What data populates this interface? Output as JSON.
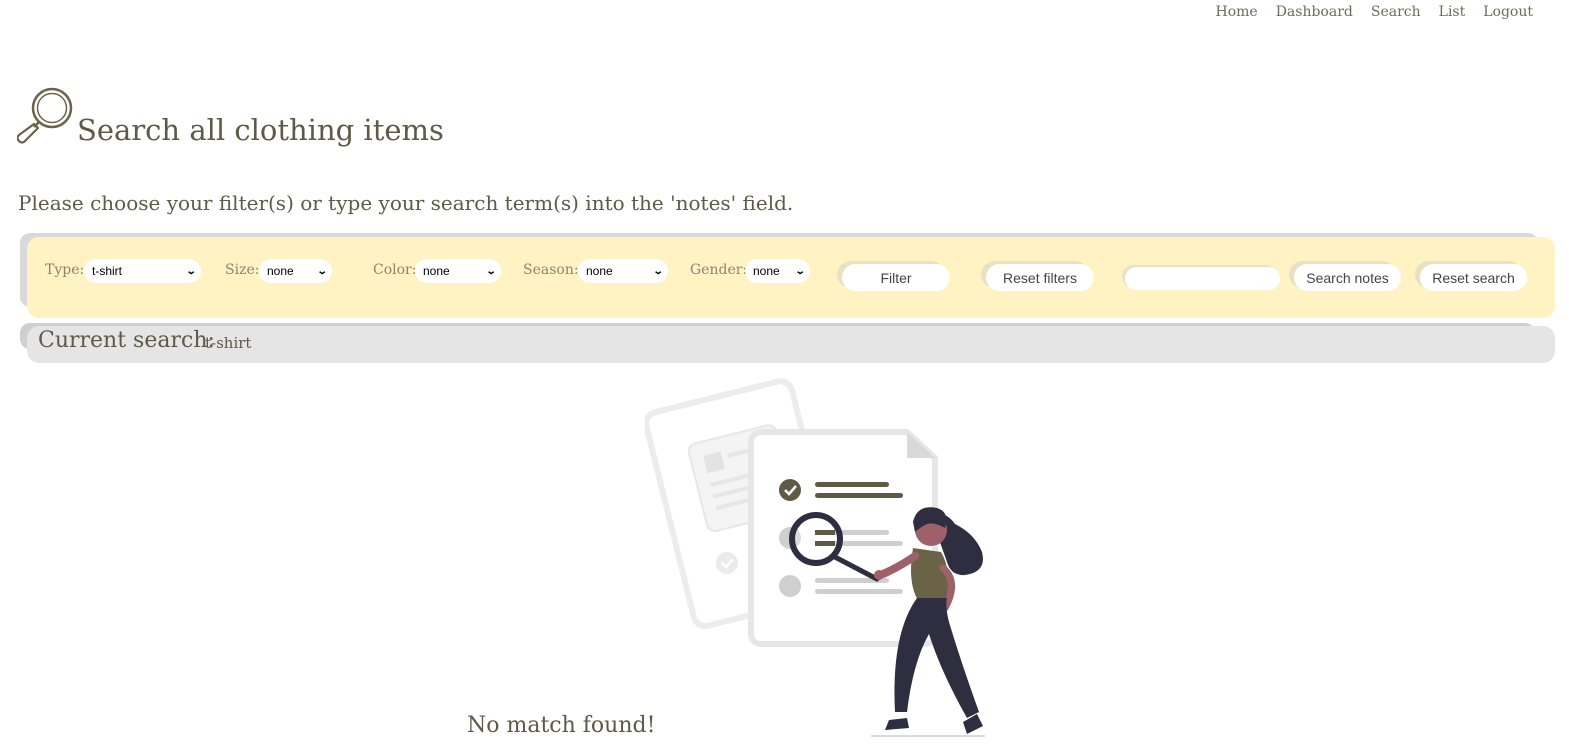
{
  "nav": {
    "items": [
      "Home",
      "Dashboard",
      "Search",
      "List",
      "Logout"
    ]
  },
  "header": {
    "title": "Search all clothing items",
    "icon": "magnifier-icon"
  },
  "instruction": "Please choose your filter(s) or type your search term(s) into the 'notes' field.",
  "filters": {
    "type": {
      "label": "Type:",
      "value": "t-shirt"
    },
    "size": {
      "label": "Size:",
      "value": "none"
    },
    "color": {
      "label": "Color:",
      "value": "none"
    },
    "season": {
      "label": "Season:",
      "value": "none"
    },
    "gender": {
      "label": "Gender:",
      "value": "none"
    },
    "filter_button": "Filter",
    "reset_filters_button": "Reset filters",
    "notes_input_value": "",
    "search_notes_button": "Search notes",
    "reset_search_button": "Reset search"
  },
  "current_search": {
    "label": "Current search:",
    "value": "t-shirt"
  },
  "result": {
    "message": "No match found!"
  },
  "colors": {
    "text": "#5e5a45",
    "filter_bar": "#fff3c3",
    "current_bar": "#e5e5e5",
    "accent": "#6b6348"
  }
}
